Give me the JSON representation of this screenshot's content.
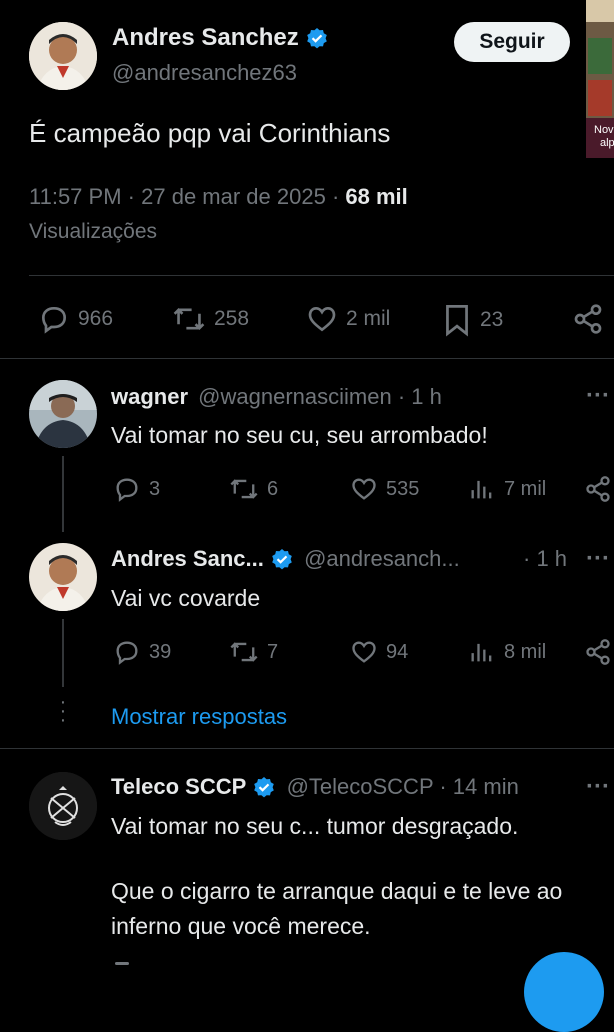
{
  "main_tweet": {
    "author_name": "Andres Sanchez",
    "handle": "@andresanchez63",
    "follow_label": "Seguir",
    "text": "É campeão pqp vai Corinthians",
    "time": "11:57 PM",
    "sep": "·",
    "date": "27 de mar de 2025",
    "views_count": "68 mil",
    "views_label": "Visualizações",
    "stats": {
      "replies": "966",
      "retweets": "258",
      "likes": "2 mil",
      "bookmarks": "23"
    }
  },
  "side_thumbnail": {
    "text_line1": "Nov",
    "text_line2": "alp"
  },
  "replies": [
    {
      "author_name": "wagner",
      "handle": "@wagnernasciimen",
      "time": "· 1 h",
      "text": "Vai tomar no seu cu, seu arrombado!",
      "stats": {
        "replies": "3",
        "retweets": "6",
        "likes": "535",
        "views": "7 mil"
      }
    },
    {
      "author_name": "Andres Sanc...",
      "handle": "@andresanch...",
      "time": "· 1 h",
      "text": "Vai vc covarde",
      "stats": {
        "replies": "39",
        "retweets": "7",
        "likes": "94",
        "views": "8 mil"
      }
    },
    {
      "author_name": "Teleco SCCP",
      "handle": "@TelecoSCCP",
      "time": "· 14 min",
      "text_line1": "Vai tomar no seu c... tumor desgraçado.",
      "text_line2": "Que o cigarro te arranque daqui e te leve ao",
      "text_line3": "inferno que você merece."
    }
  ],
  "show_replies_label": "Mostrar respostas",
  "more_label": "···",
  "colors": {
    "accent": "#1d9bf0",
    "background": "#000000",
    "muted": "#71767b",
    "divider": "#2f3336"
  }
}
